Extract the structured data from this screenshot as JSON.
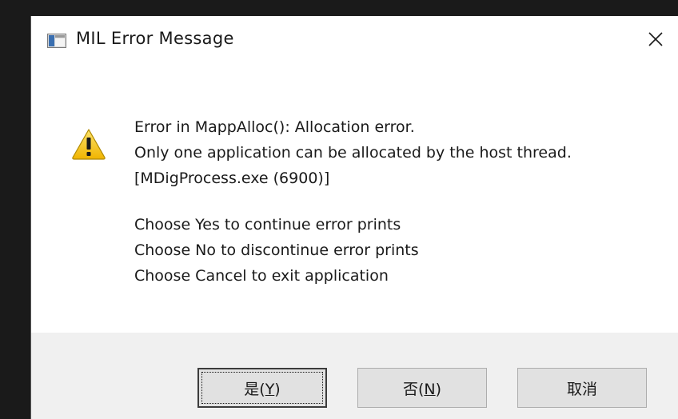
{
  "dialog": {
    "title": "MIL Error Message",
    "close_glyph": "✕",
    "icons": {
      "app": "app-window-icon",
      "warning": "warning-icon",
      "close": "close-icon"
    }
  },
  "message": {
    "lines": [
      "Error in MappAlloc(): Allocation error.",
      "Only one application can be allocated by the host thread.",
      "[MDigProcess.exe (6900)]"
    ],
    "choices": [
      "Choose Yes to continue error prints",
      "Choose No to discontinue error prints",
      "Choose Cancel to exit application"
    ]
  },
  "buttons": {
    "yes": {
      "label": "是(",
      "mnemonic": "Y",
      "suffix": ")"
    },
    "no": {
      "label": "否(",
      "mnemonic": "N",
      "suffix": ")"
    },
    "cancel": {
      "label": "取消"
    }
  },
  "colors": {
    "warning_fill": "#f5c400",
    "warning_stroke": "#b08900",
    "footer_bg": "#f0f0f0",
    "button_bg": "#e1e1e1"
  }
}
